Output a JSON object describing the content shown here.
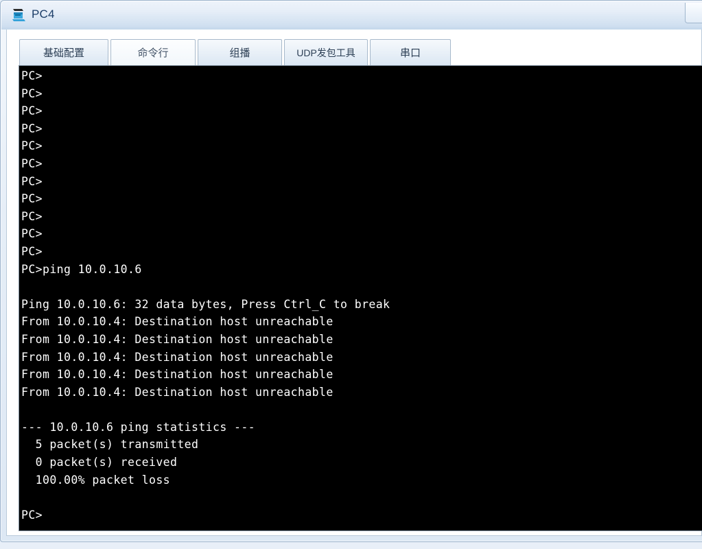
{
  "window": {
    "title": "PC4",
    "icon": "pc-device-icon",
    "close_button_label": "",
    "accent_color": "#1b3d68",
    "titlebar_color": "#cfdff0"
  },
  "tabs": [
    {
      "label": "基础配置",
      "name": "tab-basic-config",
      "active": false
    },
    {
      "label": "命令行",
      "name": "tab-command-line",
      "active": true
    },
    {
      "label": "组播",
      "name": "tab-multicast",
      "active": false
    },
    {
      "label": "UDP发包工具",
      "name": "tab-udp-tool",
      "active": false
    },
    {
      "label": "串口",
      "name": "tab-serial-port",
      "active": false
    }
  ],
  "terminal": {
    "prompt": "PC>",
    "background_color": "#000000",
    "text_color": "#ffffff",
    "command": "ping 10.0.10.6",
    "target_ip": "10.0.10.6",
    "source_ip": "10.0.10.4",
    "data_bytes": "32",
    "lines": [
      "PC>",
      "PC>",
      "PC>",
      "PC>",
      "PC>",
      "PC>",
      "PC>",
      "PC>",
      "PC>",
      "PC>",
      "PC>",
      "PC>ping 10.0.10.6",
      "",
      "Ping 10.0.10.6: 32 data bytes, Press Ctrl_C to break",
      "From 10.0.10.4: Destination host unreachable",
      "From 10.0.10.4: Destination host unreachable",
      "From 10.0.10.4: Destination host unreachable",
      "From 10.0.10.4: Destination host unreachable",
      "From 10.0.10.4: Destination host unreachable",
      "",
      "--- 10.0.10.6 ping statistics ---",
      "  5 packet(s) transmitted",
      "  0 packet(s) received",
      "  100.00% packet loss",
      "",
      "PC>"
    ],
    "statistics": {
      "header": "--- 10.0.10.6 ping statistics ---",
      "transmitted": "  5 packet(s) transmitted",
      "received": "  0 packet(s) received",
      "loss": "  100.00% packet loss"
    }
  }
}
